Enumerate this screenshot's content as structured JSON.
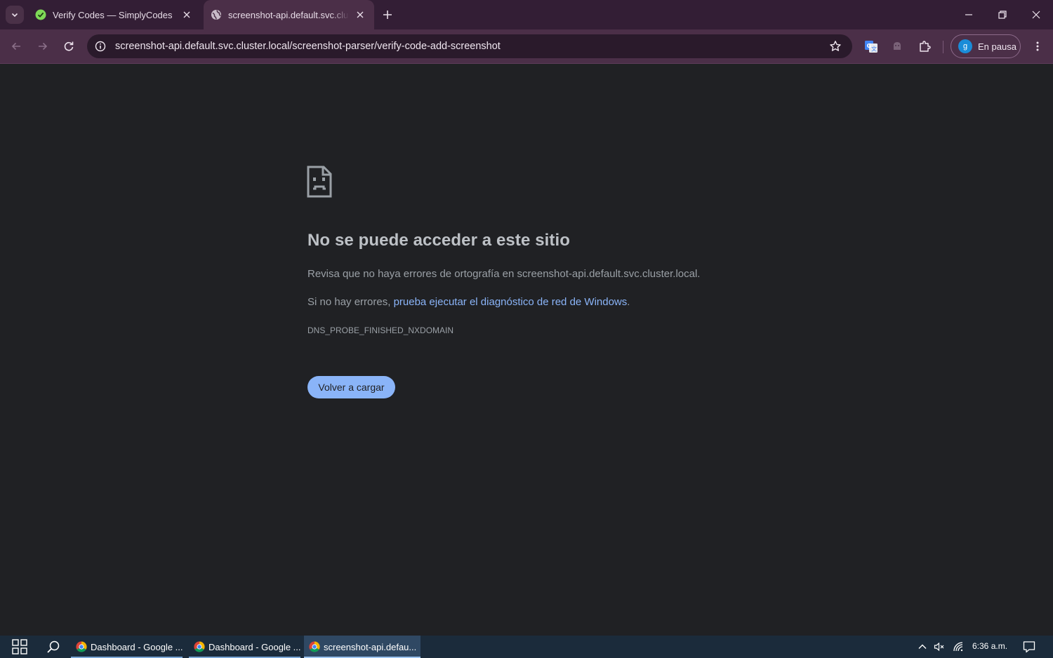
{
  "browser": {
    "tabs": [
      {
        "title": "Verify Codes — SimplyCodes",
        "favicon": "simplycodes-check-icon",
        "active": false
      },
      {
        "title": "screenshot-api.default.svc.cluster.local",
        "favicon": "globe-icon",
        "active": true
      }
    ],
    "address_bar": {
      "url": "screenshot-api.default.svc.cluster.local/screenshot-parser/verify-code-add-screenshot"
    },
    "profile": {
      "initial": "g",
      "label": "En pausa"
    }
  },
  "error_page": {
    "title": "No se puede acceder a este sitio",
    "line1": "Revisa que no haya errores de ortografía en screenshot-api.default.svc.cluster.local.",
    "line2_prefix": "Si no hay errores, ",
    "line2_link": "prueba ejecutar el diagnóstico de red de Windows",
    "line2_suffix": ".",
    "error_code": "DNS_PROBE_FINISHED_NXDOMAIN",
    "reload_label": "Volver a cargar"
  },
  "taskbar": {
    "apps": [
      {
        "label": "Dashboard - Google ...",
        "icon": "chrome-icon",
        "active": false
      },
      {
        "label": "Dashboard - Google ...",
        "icon": "chrome-icon",
        "active": false
      },
      {
        "label": "screenshot-api.defau...",
        "icon": "chrome-icon",
        "active": true
      }
    ],
    "clock": "6:36 a.m."
  },
  "colors": {
    "tab_strip": "#331e35",
    "toolbar": "#4b2f48",
    "page_background": "#202124",
    "link": "#8ab4f8",
    "taskbar": "#1b2b3b"
  }
}
